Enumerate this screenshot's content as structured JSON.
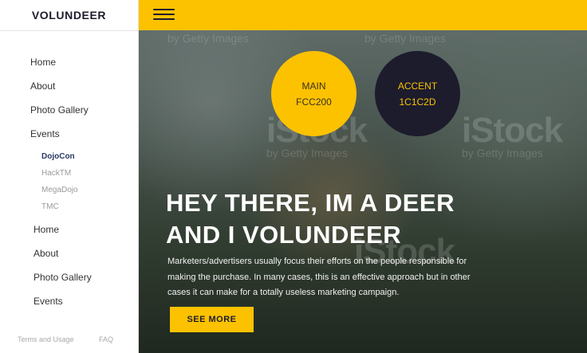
{
  "brand": {
    "logo": "VOLUNDEER"
  },
  "colors": {
    "main": "#FCC200",
    "accent": "#1C1C2D"
  },
  "sidebar": {
    "items": [
      {
        "label": "Home"
      },
      {
        "label": "About"
      },
      {
        "label": "Photo Gallery"
      },
      {
        "label": "Events"
      }
    ],
    "events_sub": [
      {
        "label": "DojoCon",
        "active": true
      },
      {
        "label": "HackTM"
      },
      {
        "label": "MegaDojo"
      },
      {
        "label": "TMC"
      }
    ],
    "items_lower": [
      {
        "label": "Home"
      },
      {
        "label": "About"
      },
      {
        "label": "Photo Gallery"
      },
      {
        "label": "Events"
      }
    ],
    "footer": {
      "terms": "Terms and Usage",
      "faq": "FAQ"
    }
  },
  "topbar": {
    "menu_icon": "hamburger-icon"
  },
  "hero": {
    "swatch_main": {
      "label": "MAIN",
      "value": "FCC200"
    },
    "swatch_accent": {
      "label": "ACCENT",
      "value": "1C1C2D"
    },
    "headline_line1": "HEY THERE, IM A DEER",
    "headline_line2": "AND I VOLUNDEER",
    "paragraph_line1": "Marketers/advertisers usually focus their efforts on the people responsible for",
    "paragraph_line2": "making the purchase. In many cases, this is an effective approach but in other",
    "paragraph_line3": "cases it can make for a totally useless marketing campaign.",
    "cta": "SEE MORE",
    "watermark_brand": "iStock",
    "watermark_credit": "by Getty Images"
  }
}
